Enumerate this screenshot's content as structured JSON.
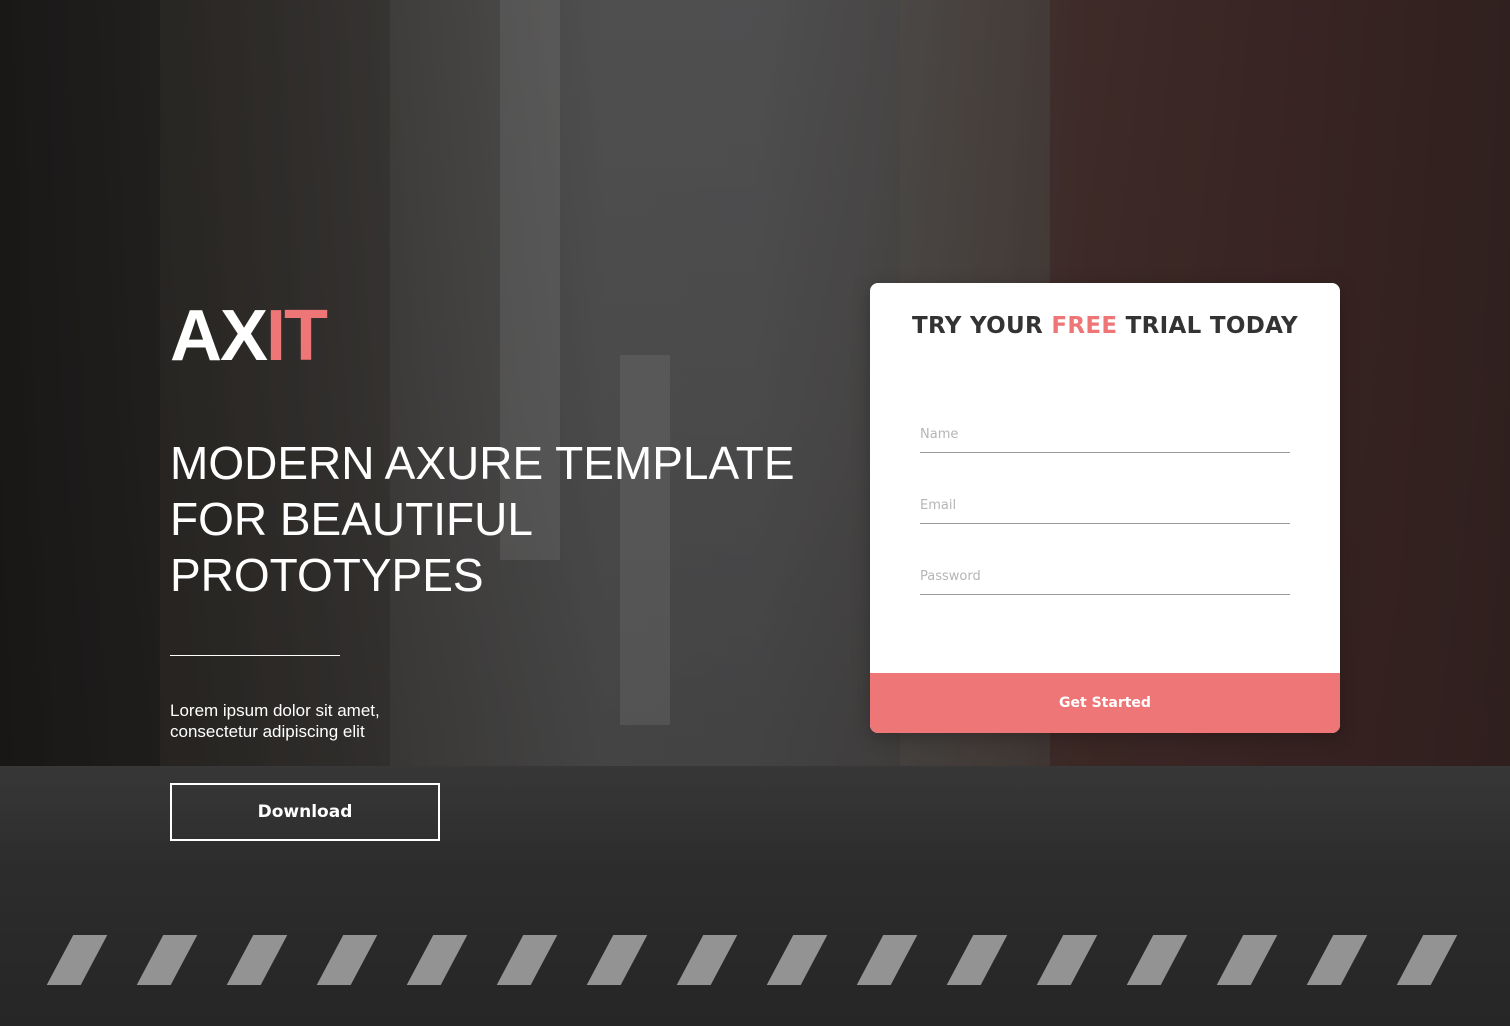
{
  "brand": {
    "logo_primary": "AX",
    "logo_accent": "IT",
    "accent_color": "#ee7676"
  },
  "hero": {
    "headline_lines": [
      "MODERN AXURE TEMPLATE",
      "FOR BEAUTIFUL",
      "PROTOTYPES"
    ],
    "lead_lines": [
      "Lorem ipsum dolor sit amet,",
      "consectetur adipiscing elit"
    ],
    "download_label": "Download"
  },
  "signup": {
    "title_before": "TRY YOUR ",
    "title_highlight": "FREE",
    "title_after": " TRIAL TODAY",
    "fields": [
      {
        "placeholder": "Name",
        "value": ""
      },
      {
        "placeholder": "Email",
        "value": ""
      },
      {
        "placeholder": "Password",
        "value": ""
      }
    ],
    "submit_label": "Get Started"
  }
}
